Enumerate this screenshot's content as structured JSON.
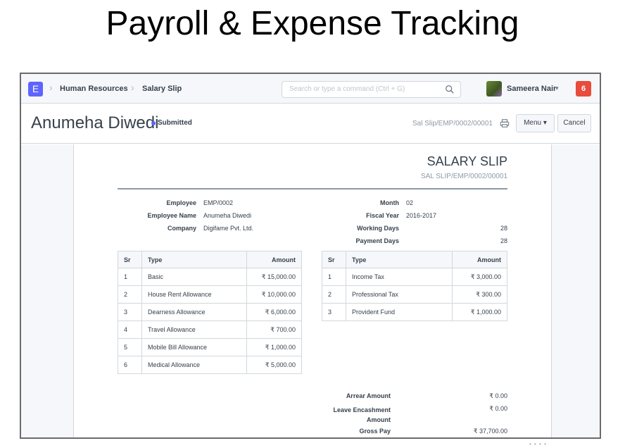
{
  "slide": {
    "title": "Payroll & Expense Tracking"
  },
  "navbar": {
    "logo_letter": "E",
    "breadcrumbs": [
      "Human Resources",
      "Salary Slip"
    ],
    "search_placeholder": "Search or type a command (Ctrl + G)",
    "user_name": "Sameera Nair",
    "notification_count": "6"
  },
  "page_head": {
    "title": "Anumeha Diwedi",
    "status": "Submitted",
    "doc_name": "Sal Slip/EMP/0002/00001",
    "menu_label": "Menu",
    "cancel_label": "Cancel"
  },
  "slip": {
    "title": "SALARY SLIP",
    "number": "SAL SLIP/EMP/0002/00001",
    "left_fields": [
      {
        "label": "Employee",
        "value": "EMP/0002"
      },
      {
        "label": "Employee Name",
        "value": "Anumeha Diwedi"
      },
      {
        "label": "Company",
        "value": "Digifame Pvt. Ltd."
      }
    ],
    "right_fields": [
      {
        "label": "Month",
        "value": "02"
      },
      {
        "label": "Fiscal Year",
        "value": "2016-2017"
      },
      {
        "label": "Working Days",
        "value": "28"
      },
      {
        "label": "Payment Days",
        "value": "28"
      }
    ],
    "earnings": {
      "headers": [
        "Sr",
        "Type",
        "Amount"
      ],
      "rows": [
        [
          "1",
          "Basic",
          "₹ 15,000.00"
        ],
        [
          "2",
          "House Rent Allowance",
          "₹ 10,000.00"
        ],
        [
          "3",
          "Dearness Allowance",
          "₹ 6,000.00"
        ],
        [
          "4",
          "Travel Allowance",
          "₹ 700.00"
        ],
        [
          "5",
          "Mobile Bill Allowance",
          "₹ 1,000.00"
        ],
        [
          "6",
          "Medical Allowance",
          "₹ 5,000.00"
        ]
      ]
    },
    "deductions": {
      "headers": [
        "Sr",
        "Type",
        "Amount"
      ],
      "rows": [
        [
          "1",
          "Income Tax",
          "₹ 3,000.00"
        ],
        [
          "2",
          "Professional Tax",
          "₹ 300.00"
        ],
        [
          "3",
          "Provident Fund",
          "₹ 1,000.00"
        ]
      ]
    },
    "totals": [
      {
        "label": "Arrear Amount",
        "value": "₹ 0.00"
      },
      {
        "label": "Leave Encashment Amount",
        "value": "₹ 0.00"
      },
      {
        "label": "Gross Pay",
        "value": "₹ 37,700.00"
      }
    ]
  },
  "colors": {
    "accent": "#5e64ff",
    "notification": "#e74c3c",
    "border": "#d1d8dd"
  }
}
